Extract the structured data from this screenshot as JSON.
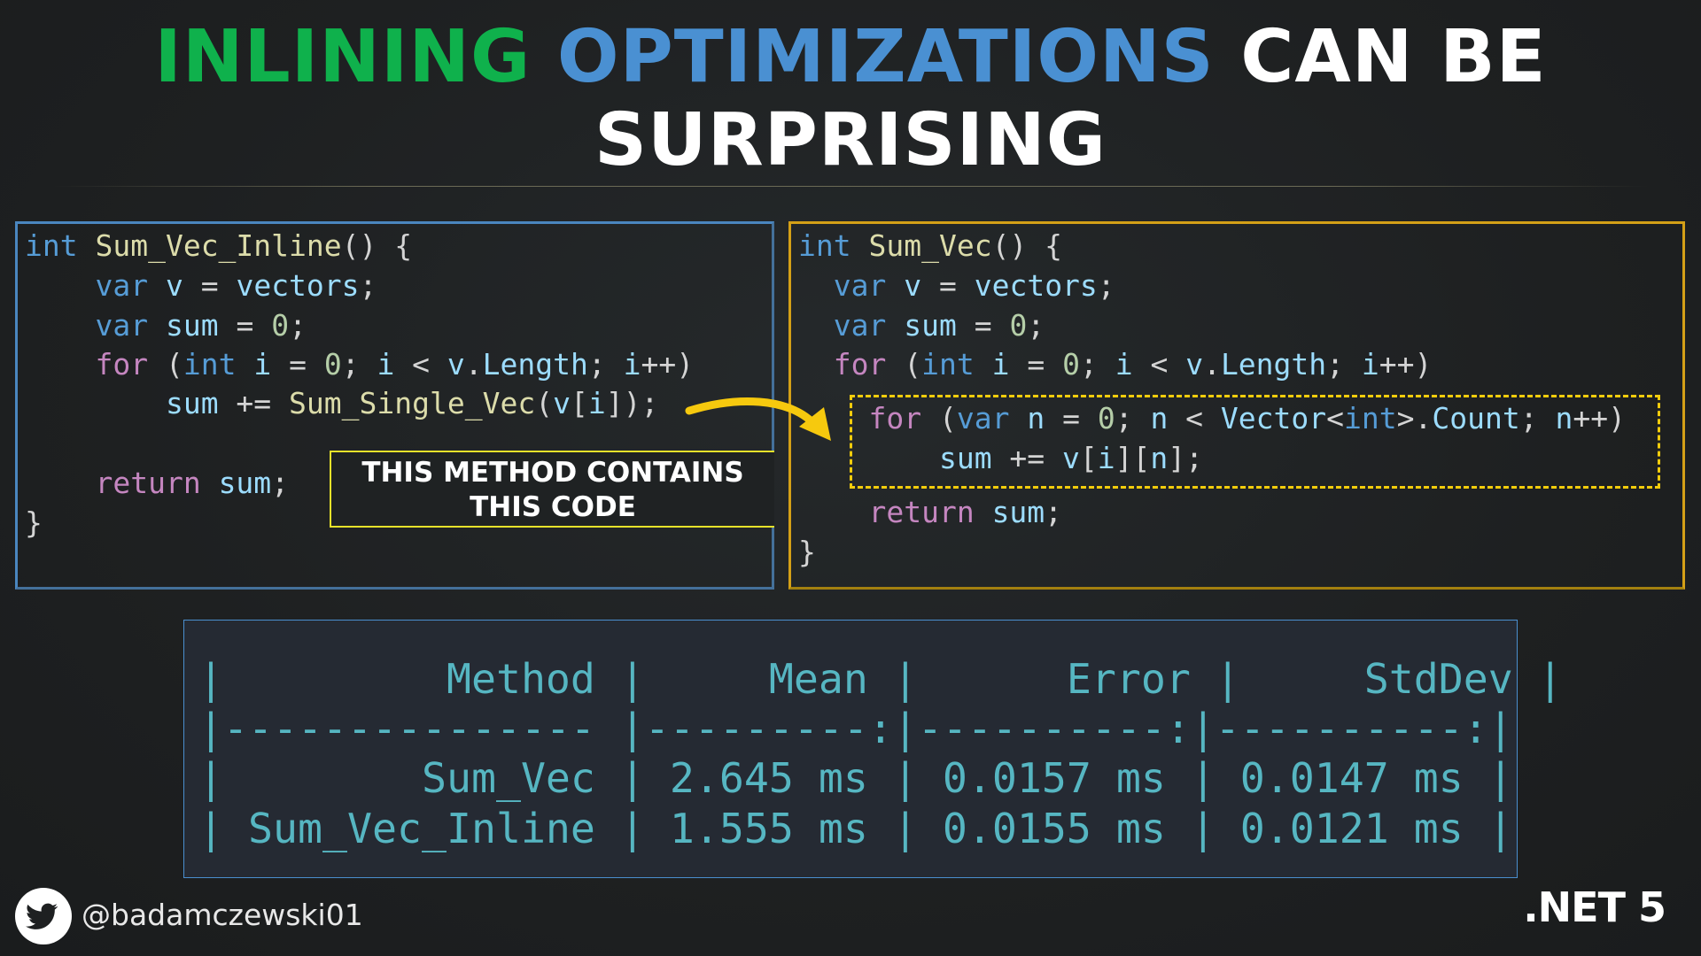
{
  "title": {
    "word1": "INLINING",
    "word2": "OPTIMIZATIONS",
    "word3": "CAN BE",
    "line2": "SURPRISING"
  },
  "colors": {
    "inlining": "#0fb14c",
    "optimizations": "#4a90d2",
    "left_box": "#4a86bf",
    "right_box": "#d4a017",
    "highlight": "#f2cc0c",
    "table_text": "#56b6c2"
  },
  "left_code": [
    [
      [
        "kw",
        "int "
      ],
      [
        "fn",
        "Sum_Vec_Inline"
      ],
      [
        "pn",
        "() {"
      ]
    ],
    [
      [
        "pn",
        "    "
      ],
      [
        "kw",
        "var "
      ],
      [
        "vr",
        "v"
      ],
      [
        "pn",
        " = "
      ],
      [
        "vr",
        "vectors"
      ],
      [
        "pn",
        ";"
      ]
    ],
    [
      [
        "pn",
        "    "
      ],
      [
        "kw",
        "var "
      ],
      [
        "vr",
        "sum"
      ],
      [
        "pn",
        " = "
      ],
      [
        "num",
        "0"
      ],
      [
        "pn",
        ";"
      ]
    ],
    [
      [
        "pn",
        "    "
      ],
      [
        "ctl",
        "for "
      ],
      [
        "pn",
        "("
      ],
      [
        "kw",
        "int "
      ],
      [
        "vr",
        "i"
      ],
      [
        "pn",
        " = "
      ],
      [
        "num",
        "0"
      ],
      [
        "pn",
        "; "
      ],
      [
        "vr",
        "i"
      ],
      [
        "pn",
        " < "
      ],
      [
        "vr",
        "v"
      ],
      [
        "pn",
        "."
      ],
      [
        "vr",
        "Length"
      ],
      [
        "pn",
        "; "
      ],
      [
        "vr",
        "i"
      ],
      [
        "pn",
        "++)"
      ]
    ],
    [
      [
        "pn",
        "        "
      ],
      [
        "vr",
        "sum"
      ],
      [
        "pn",
        " += "
      ],
      [
        "fn",
        "Sum_Single_Vec"
      ],
      [
        "pn",
        "("
      ],
      [
        "vr",
        "v"
      ],
      [
        "pn",
        "["
      ],
      [
        "vr",
        "i"
      ],
      [
        "pn",
        "]);"
      ]
    ],
    [],
    [
      [
        "pn",
        "    "
      ],
      [
        "ctl",
        "return "
      ],
      [
        "vr",
        "sum"
      ],
      [
        "pn",
        ";"
      ]
    ],
    [
      [
        "pn",
        "}"
      ]
    ]
  ],
  "right_code": [
    [
      [
        "kw",
        "int "
      ],
      [
        "fn",
        "Sum_Vec"
      ],
      [
        "pn",
        "() {"
      ]
    ],
    [
      [
        "pn",
        "  "
      ],
      [
        "kw",
        "var "
      ],
      [
        "vr",
        "v"
      ],
      [
        "pn",
        " = "
      ],
      [
        "vr",
        "vectors"
      ],
      [
        "pn",
        ";"
      ]
    ],
    [
      [
        "pn",
        "  "
      ],
      [
        "kw",
        "var "
      ],
      [
        "vr",
        "sum"
      ],
      [
        "pn",
        " = "
      ],
      [
        "num",
        "0"
      ],
      [
        "pn",
        ";"
      ]
    ],
    [
      [
        "pn",
        "  "
      ],
      [
        "ctl",
        "for "
      ],
      [
        "pn",
        "("
      ],
      [
        "kw",
        "int "
      ],
      [
        "vr",
        "i"
      ],
      [
        "pn",
        " = "
      ],
      [
        "num",
        "0"
      ],
      [
        "pn",
        "; "
      ],
      [
        "vr",
        "i"
      ],
      [
        "pn",
        " < "
      ],
      [
        "vr",
        "v"
      ],
      [
        "pn",
        "."
      ],
      [
        "vr",
        "Length"
      ],
      [
        "pn",
        "; "
      ],
      [
        "vr",
        "i"
      ],
      [
        "pn",
        "++)"
      ]
    ],
    [
      [
        "pn",
        "    "
      ],
      [
        "ctl",
        "for "
      ],
      [
        "pn",
        "("
      ],
      [
        "kw",
        "var "
      ],
      [
        "vr",
        "n"
      ],
      [
        "pn",
        " = "
      ],
      [
        "num",
        "0"
      ],
      [
        "pn",
        "; "
      ],
      [
        "vr",
        "n"
      ],
      [
        "pn",
        " < "
      ],
      [
        "vr",
        "Vector"
      ],
      [
        "pn",
        "<"
      ],
      [
        "kw",
        "int"
      ],
      [
        "pn",
        ">."
      ],
      [
        "vr",
        "Count"
      ],
      [
        "pn",
        "; "
      ],
      [
        "vr",
        "n"
      ],
      [
        "pn",
        "++)"
      ]
    ],
    [
      [
        "pn",
        "        "
      ],
      [
        "vr",
        "sum"
      ],
      [
        "pn",
        " += "
      ],
      [
        "vr",
        "v"
      ],
      [
        "pn",
        "["
      ],
      [
        "vr",
        "i"
      ],
      [
        "pn",
        "]["
      ],
      [
        "vr",
        "n"
      ],
      [
        "pn",
        "];"
      ]
    ],
    [
      [
        "pn",
        "    "
      ],
      [
        "ctl",
        "return "
      ],
      [
        "vr",
        "sum"
      ],
      [
        "pn",
        ";"
      ]
    ],
    [
      [
        "pn",
        "}"
      ]
    ]
  ],
  "callout": {
    "line1": "THIS METHOD CONTAINS",
    "line2": "THIS CODE"
  },
  "benchmark": {
    "header": "|         Method |     Mean |      Error |     StdDev |",
    "separator": "|--------------- |---------:|----------:|----------:|",
    "rows": [
      "|        Sum_Vec | 2.645 ms | 0.0157 ms | 0.0147 ms |",
      "| Sum_Vec_Inline | 1.555 ms | 0.0155 ms | 0.0121 ms |"
    ],
    "columns": [
      "Method",
      "Mean",
      "Error",
      "StdDev"
    ],
    "data": [
      {
        "Method": "Sum_Vec",
        "Mean": "2.645 ms",
        "Error": "0.0157 ms",
        "StdDev": "0.0147 ms"
      },
      {
        "Method": "Sum_Vec_Inline",
        "Mean": "1.555 ms",
        "Error": "0.0155 ms",
        "StdDev": "0.0121 ms"
      }
    ]
  },
  "footer": {
    "icon": "twitter-bird-icon",
    "handle": "@badamczewski01",
    "badge": ".NET 5"
  }
}
